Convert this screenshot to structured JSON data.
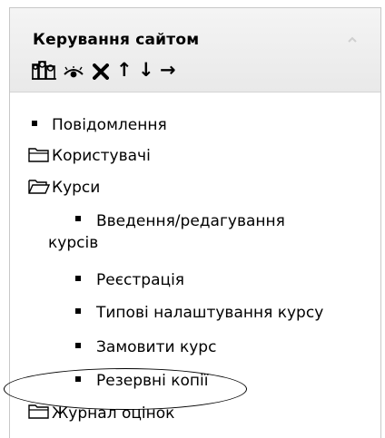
{
  "block": {
    "title": "Керування сайтом"
  },
  "controls": {
    "move_up": "↑",
    "move_down": "↓",
    "move_right": "→"
  },
  "menu": {
    "messages": "Повідомлення",
    "users": "Користувачі",
    "courses": "Курси",
    "course_items": {
      "edit_courses_line1": "Введення/редагування",
      "edit_courses_line2": "курсів",
      "registration": "Реєстрація",
      "default_settings": "Типові налаштування курсу",
      "request_course": "Замовити курс",
      "backups": "Резервні копії"
    },
    "gradebook": "Журнал оцінок"
  },
  "colors": {
    "header_bg": "#eeeeee",
    "border": "#c8c8c8"
  }
}
